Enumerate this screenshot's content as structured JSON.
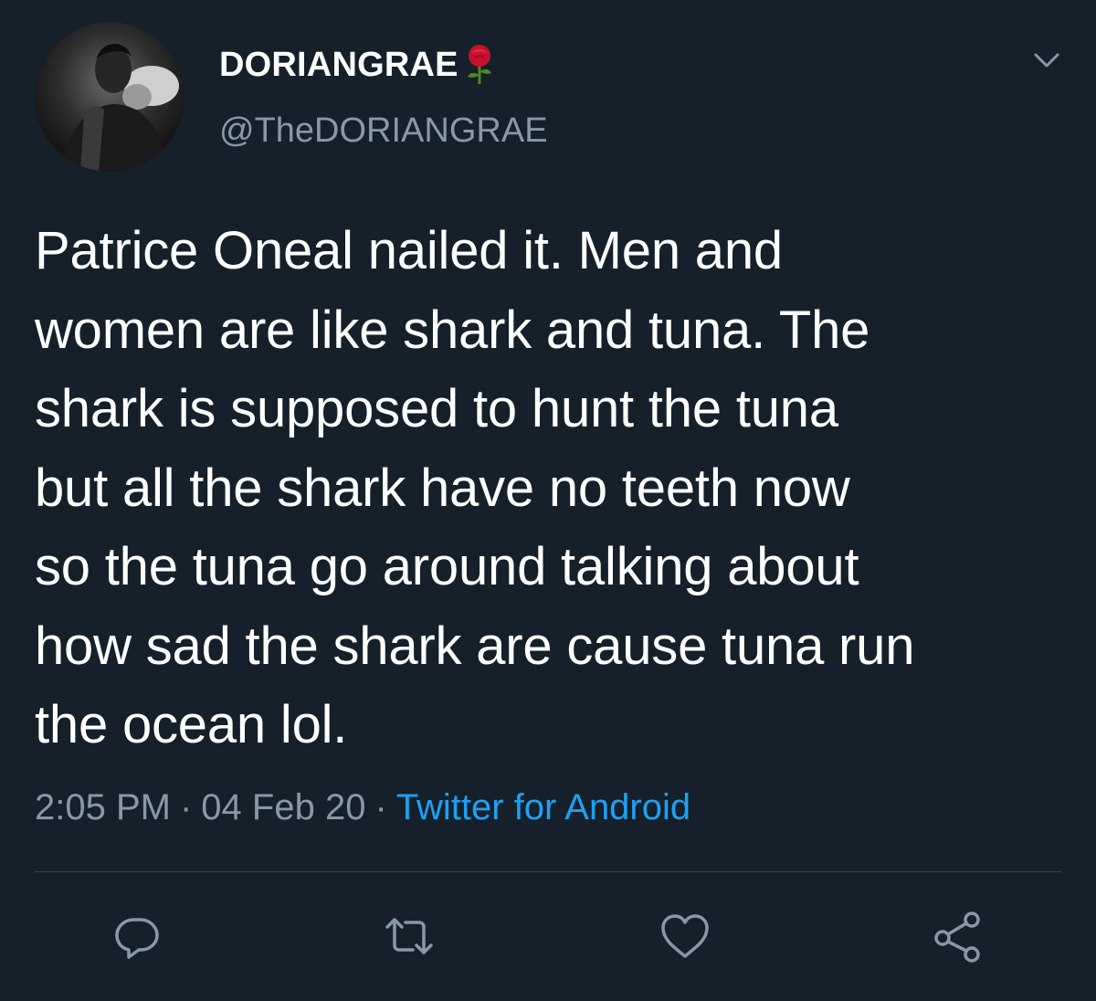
{
  "tweet": {
    "author": {
      "display_name": "DORIANGRAE",
      "handle": "@TheDORIANGRAE",
      "name_emoji": "rose-icon"
    },
    "text": "Patrice Oneal nailed it. Men and\nwomen are like shark and tuna. The\nshark is supposed to hunt the tuna\nbut all the shark have no teeth now\nso the tuna go around talking about\nhow sad the shark are cause tuna run\nthe ocean lol.",
    "time": "2:05 PM",
    "separator": "·",
    "date": "04 Feb 20",
    "source": "Twitter for Android"
  },
  "actions": [
    {
      "icon": "reply-icon"
    },
    {
      "icon": "retweet-icon"
    },
    {
      "icon": "like-icon"
    },
    {
      "icon": "share-icon"
    }
  ],
  "colors": {
    "background": "#15202b",
    "primary_text": "#ffffff",
    "secondary_text": "#8899a6",
    "link": "#1da1f2",
    "divider": "#38444d"
  }
}
